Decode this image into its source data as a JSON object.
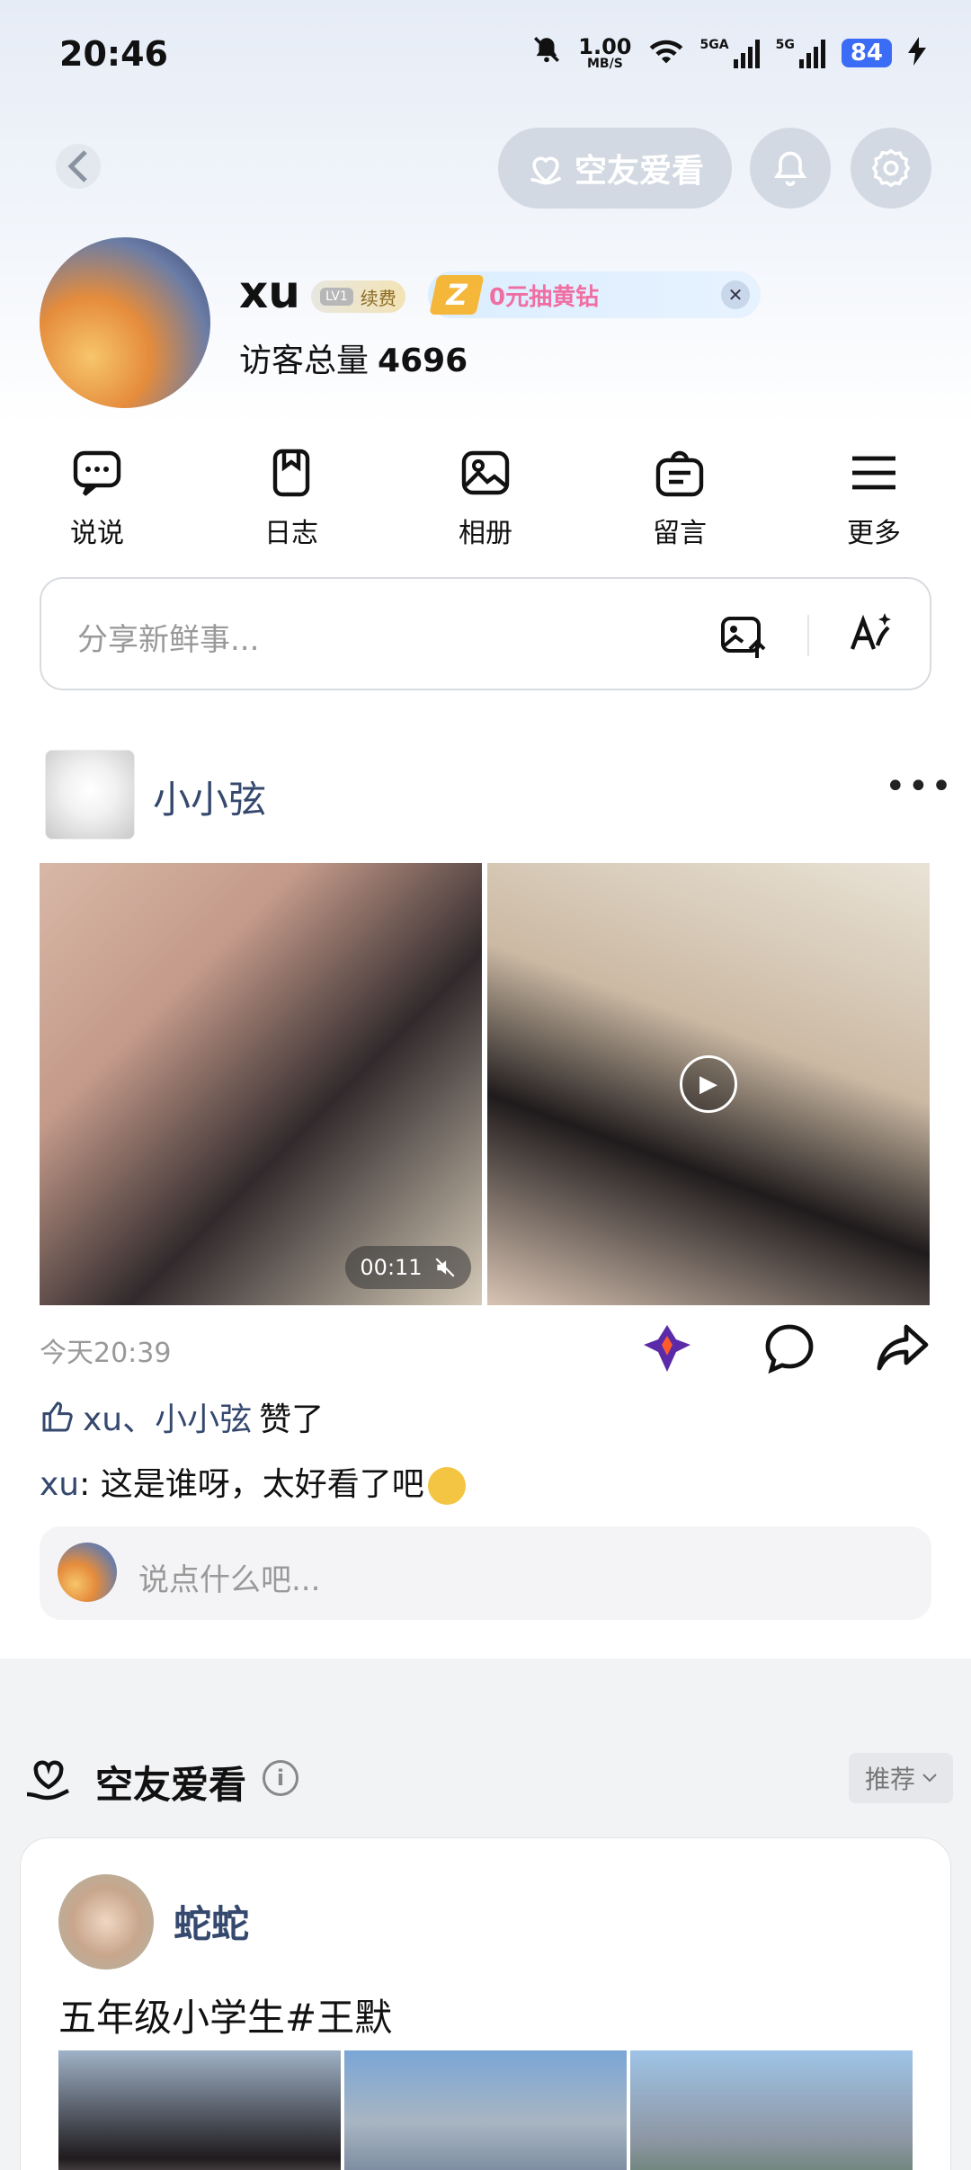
{
  "status_bar": {
    "time": "20:46",
    "net_speed_value": "1.00",
    "net_speed_unit": "MB/S",
    "sim1_label": "5GA",
    "sim2_label": "5G",
    "battery": "84"
  },
  "top_nav": {
    "feature_label": "空友爱看"
  },
  "profile": {
    "username": "xu",
    "level_badge": "LV1",
    "badge_label": "续费",
    "promo_text": "0元抽黄钻",
    "visitors_label": "访客总量",
    "visitors_count": "4696"
  },
  "quick_nav": [
    {
      "label": "说说",
      "icon": "speech-bubble-icon"
    },
    {
      "label": "日志",
      "icon": "bookmark-icon"
    },
    {
      "label": "相册",
      "icon": "image-icon"
    },
    {
      "label": "留言",
      "icon": "message-board-icon"
    },
    {
      "label": "更多",
      "icon": "menu-icon"
    }
  ],
  "composer": {
    "placeholder": "分享新鲜事..."
  },
  "post": {
    "author": "小小弦",
    "video_duration": "00:11",
    "time": "今天20:39",
    "likes_names": "xu、小小弦",
    "likes_suffix": "赞了",
    "comment_author": "xu",
    "comment_text": ": 这是谁呀，太好看了吧",
    "reply_placeholder": "说点什么吧..."
  },
  "recommend": {
    "title": "空友爱看",
    "filter": "推荐",
    "card": {
      "author": "蛇蛇",
      "text": "五年级小学生#王默"
    }
  },
  "colors": {
    "link_blue": "#35486e",
    "battery_blue": "#3b6cf5",
    "promo_pink": "#f06fa3"
  }
}
